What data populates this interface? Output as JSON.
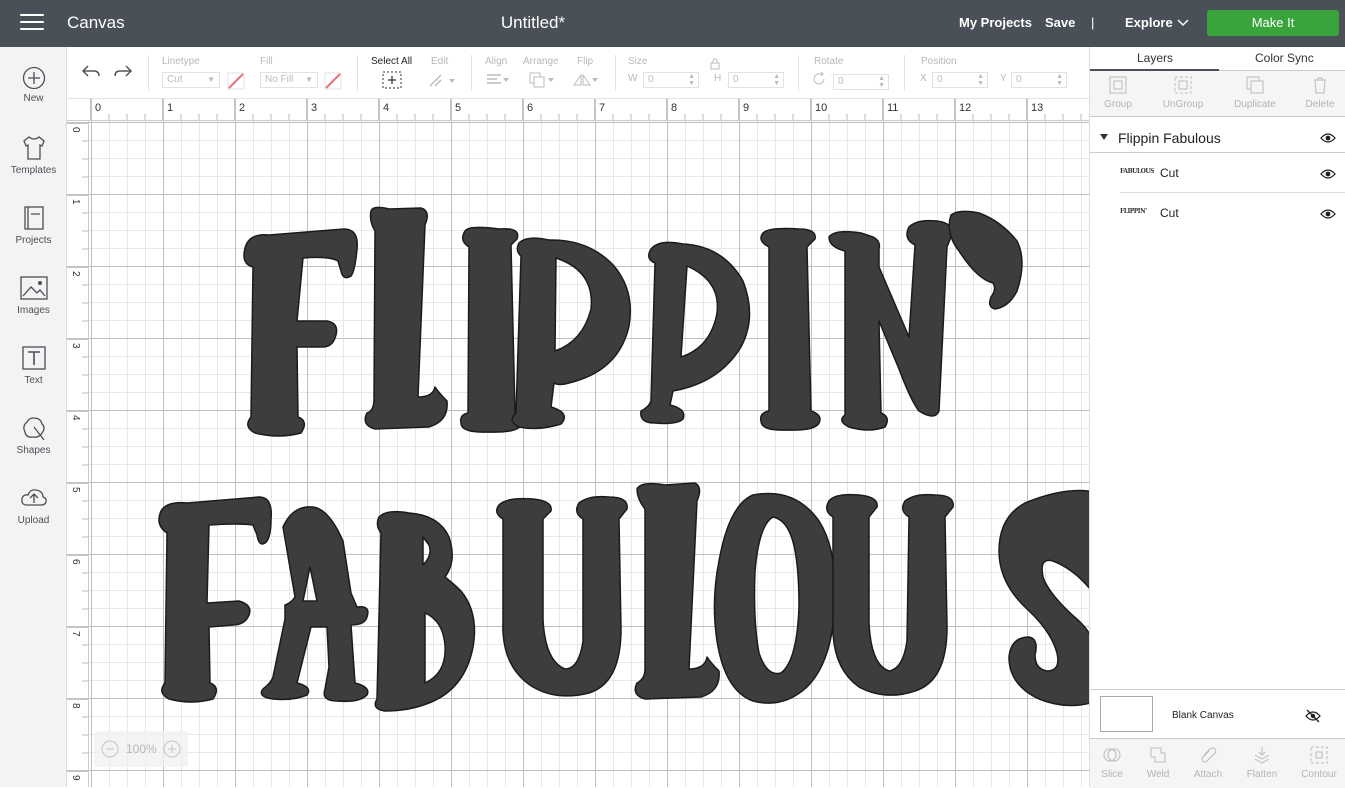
{
  "header": {
    "app_name": "Canvas",
    "doc_title": "Untitled*",
    "my_projects": "My Projects",
    "save": "Save",
    "separator": "|",
    "explore": "Explore",
    "make_it": "Make It",
    "make_it_color": "#3aa43c",
    "bar_color": "#4a5057"
  },
  "leftbar": {
    "items": [
      {
        "label": "New",
        "icon": "plus-circle-icon"
      },
      {
        "label": "Templates",
        "icon": "tshirt-icon"
      },
      {
        "label": "Projects",
        "icon": "book-icon"
      },
      {
        "label": "Images",
        "icon": "image-icon"
      },
      {
        "label": "Text",
        "icon": "text-icon"
      },
      {
        "label": "Shapes",
        "icon": "shapes-icon"
      },
      {
        "label": "Upload",
        "icon": "cloud-upload-icon"
      }
    ]
  },
  "toolbar": {
    "linetype_label": "Linetype",
    "linetype_value": "Cut",
    "fill_label": "Fill",
    "fill_value": "No Fill",
    "select_all": "Select All",
    "edit": "Edit",
    "align": "Align",
    "arrange": "Arrange",
    "flip": "Flip",
    "size": "Size",
    "w": "W",
    "w_value": "0",
    "h": "H",
    "h_value": "0",
    "rotate": "Rotate",
    "rotate_value": "0",
    "position": "Position",
    "x": "X",
    "x_value": "0",
    "y": "Y",
    "y_value": "0"
  },
  "ruler": {
    "top": [
      "0",
      "1",
      "2",
      "3",
      "4",
      "5",
      "6",
      "7",
      "8",
      "9",
      "10",
      "11",
      "12",
      "13"
    ],
    "left": [
      "0",
      "1",
      "2",
      "3",
      "4",
      "5",
      "6",
      "7",
      "8",
      "9"
    ]
  },
  "canvas": {
    "line1": "FLIPPIN’",
    "line2": "FABULOUS",
    "text_color": "#3d3d3f"
  },
  "zoom": {
    "value": "100%",
    "minus": "−",
    "plus": "+"
  },
  "right_panel": {
    "tabs": [
      "Layers",
      "Color Sync"
    ],
    "layer_tools": [
      "Group",
      "UnGroup",
      "Duplicate",
      "Delete"
    ],
    "group_name": "Flippin Fabulous",
    "layers": [
      {
        "thumb": "FABULOUS",
        "type": "Cut"
      },
      {
        "thumb": "FLIPPIN’",
        "type": "Cut"
      }
    ],
    "blank_canvas": "Blank Canvas",
    "bottom_tools": [
      "Slice",
      "Weld",
      "Attach",
      "Flatten",
      "Contour"
    ]
  }
}
